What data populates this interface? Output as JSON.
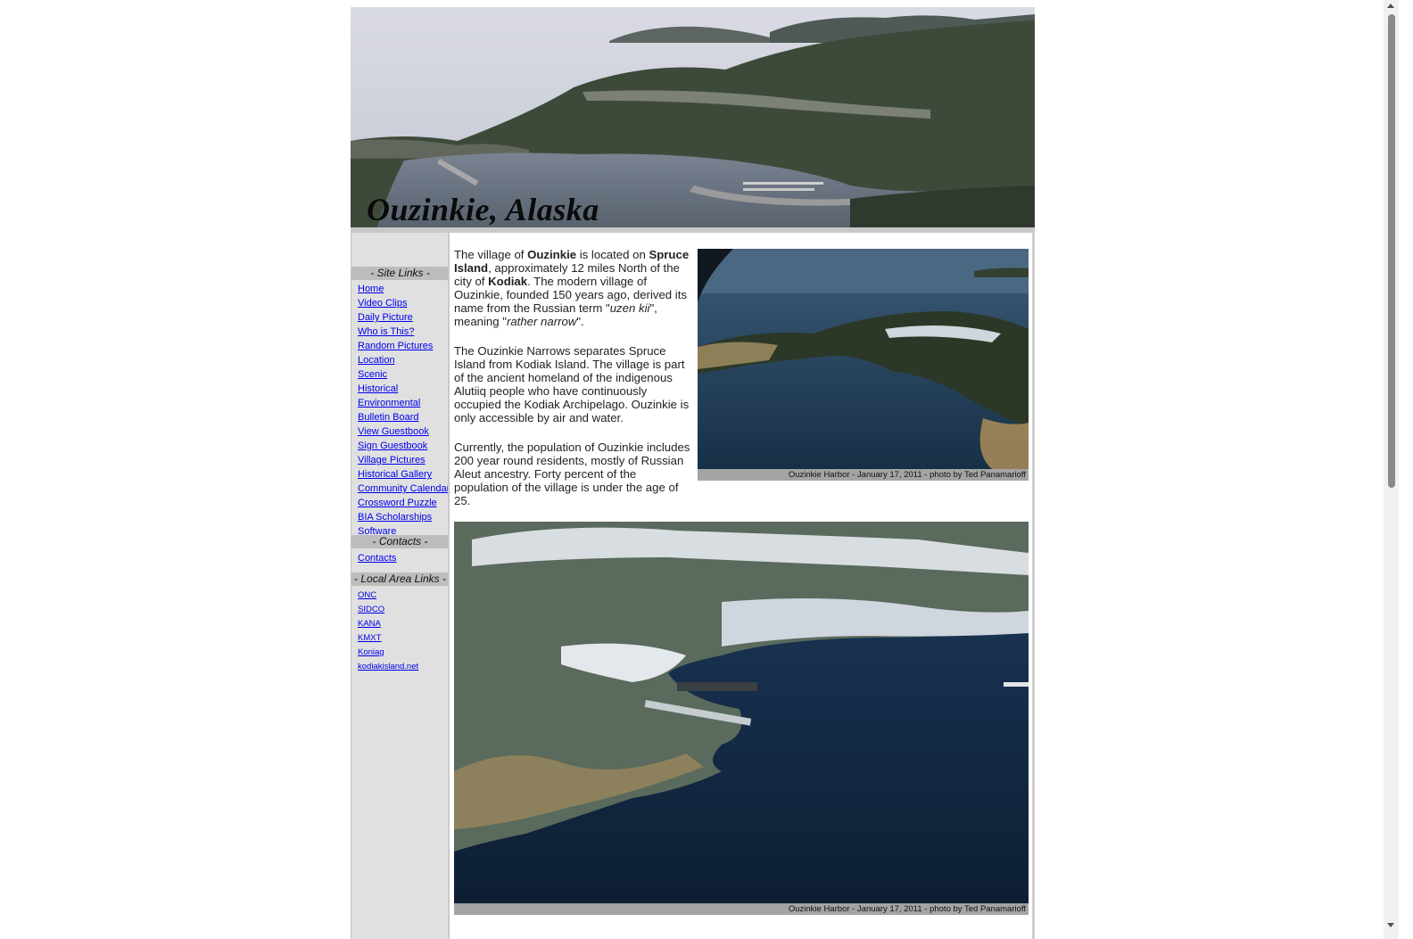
{
  "header": {
    "title": "Ouzinkie, Alaska",
    "banner_image": "aerial-photo-ouzinkie-harbor"
  },
  "sidebar": {
    "site_links_title": "- Site Links -",
    "site_links": [
      "Home",
      "Video Clips",
      "Daily Picture",
      "Who is This?",
      "Random Pictures",
      "Location",
      "Scenic",
      "Historical",
      "Environmental",
      "Bulletin Board",
      "View Guestbook",
      "Sign Guestbook",
      "Village Pictures",
      "Historical Gallery",
      "Community Calendar",
      "Crossword Puzzle",
      "BIA Scholarships",
      "Software"
    ],
    "contacts_title": "- Contacts -",
    "contacts_links": [
      "Contacts"
    ],
    "local_links_title": "- Local Area Links -",
    "local_links": [
      "ONC",
      "SIDCO",
      "KANA",
      "KMXT",
      "Koniag",
      "kodiakisland.net"
    ]
  },
  "content": {
    "p1": {
      "t1": "The village of ",
      "b1": "Ouzinkie",
      "t2": " is located on ",
      "b2": "Spruce Island",
      "t3": ", approximately 12 miles North of the city of ",
      "b3": "Kodiak",
      "t4": ". The modern village of Ouzinkie, founded 150 years ago, derived its name from the Russian term \"",
      "i1": "uzen kii",
      "t5": "\", meaning \"",
      "i2": "rather narrow",
      "t6": "\"."
    },
    "p2": "The Ouzinkie Narrows separates Spruce Island from Kodiak Island. The village is part of the ancient homeland of the indigenous Alutiiq people who have continuously occupied the Kodiak Archipelago. Ouzinkie is only accessible by air and water.",
    "p3": "Currently, the population of Ouzinkie includes 200 year round residents, mostly of Russian Aleut ancestry. Forty percent of the population of the village is under the age of 25.",
    "photo1_caption": "Ouzinkie Harbor - January 17, 2011 - photo by Ted Panamarioff",
    "photo2_caption": "Ouzinkie Harbor - January 17, 2011 - photo by Ted Panamarioff"
  }
}
